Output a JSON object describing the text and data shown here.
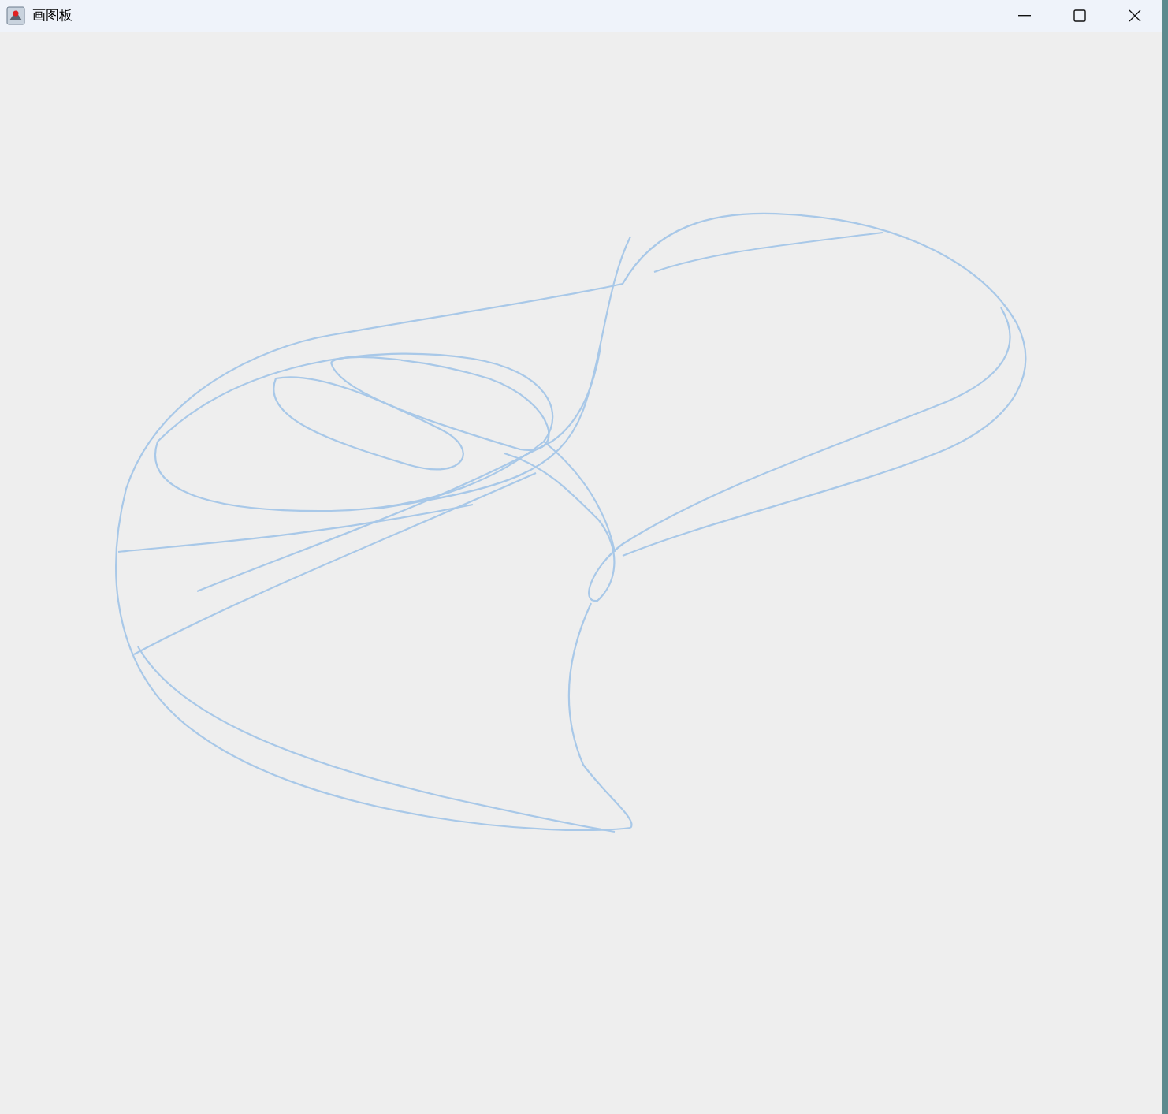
{
  "window": {
    "title": "画图板"
  }
}
